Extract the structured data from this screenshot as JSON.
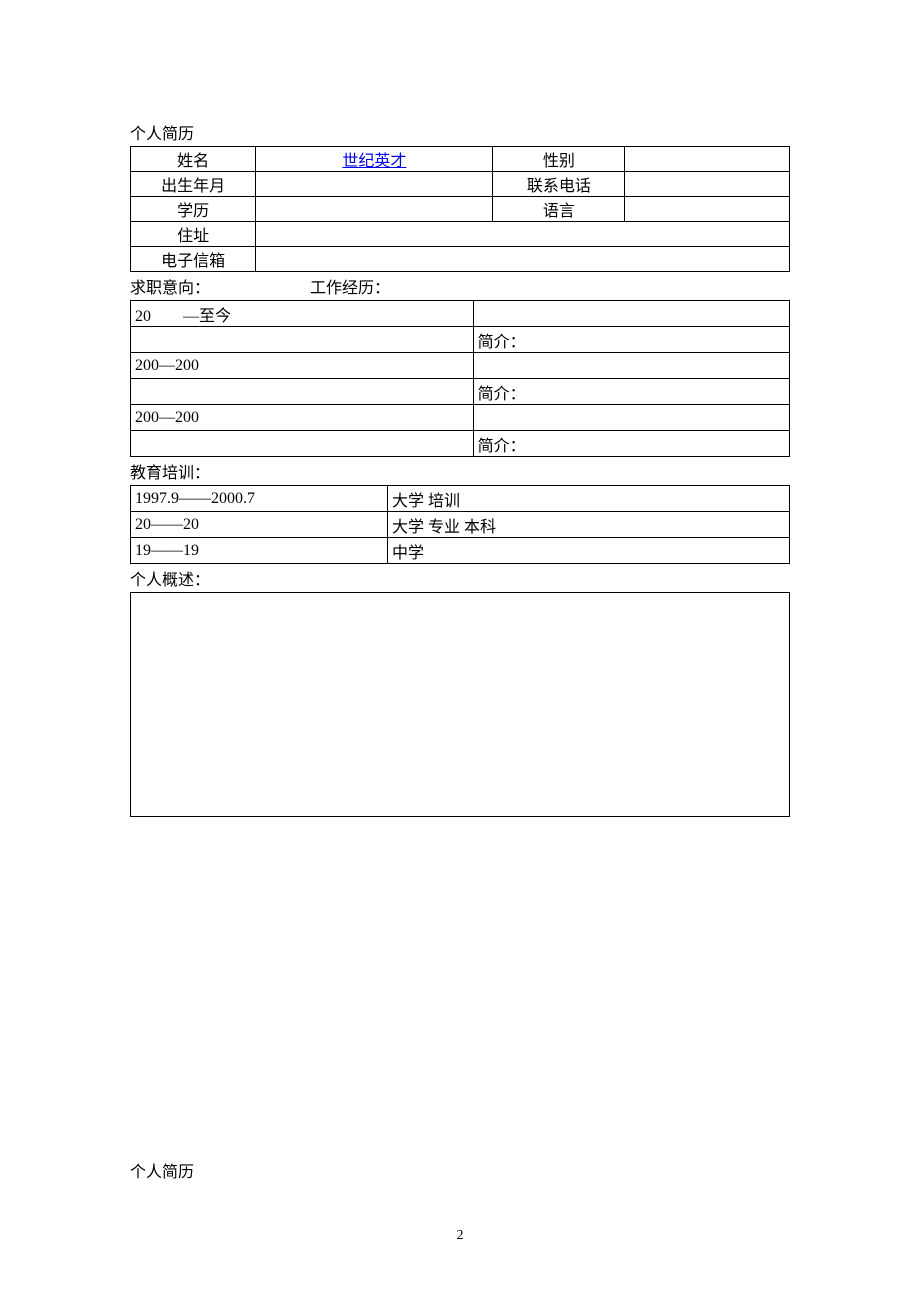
{
  "title": "个人简历",
  "info": {
    "name_label": "姓名",
    "name_value": "世纪英才",
    "gender_label": "性别",
    "gender_value": "",
    "birth_label": "出生年月",
    "birth_value": "",
    "phone_label": "联系电话",
    "phone_value": "",
    "education_label": "学历",
    "education_value": "",
    "language_label": "语言",
    "language_value": "",
    "address_label": "住址",
    "address_value": "",
    "email_label": "电子信箱",
    "email_value": ""
  },
  "job_intent_label": "求职意向：",
  "work_history_label": "工作经历：",
  "work": [
    {
      "period": "20　　—至今",
      "company": "",
      "intro_label": "简介：",
      "intro": ""
    },
    {
      "period": "200—200",
      "company": "",
      "intro_label": "简介：",
      "intro": ""
    },
    {
      "period": "200—200",
      "company": "",
      "intro_label": "简介：",
      "intro": ""
    }
  ],
  "edu_label": "教育培训：",
  "edu": [
    {
      "period": "1997.9——2000.7",
      "desc": "大学 培训"
    },
    {
      "period": "20——20",
      "desc": "大学 专业 本科"
    },
    {
      "period": "19——19",
      "desc": "中学"
    }
  ],
  "summary_label": "个人概述：",
  "footer_title": "个人简历",
  "page_number": "2"
}
